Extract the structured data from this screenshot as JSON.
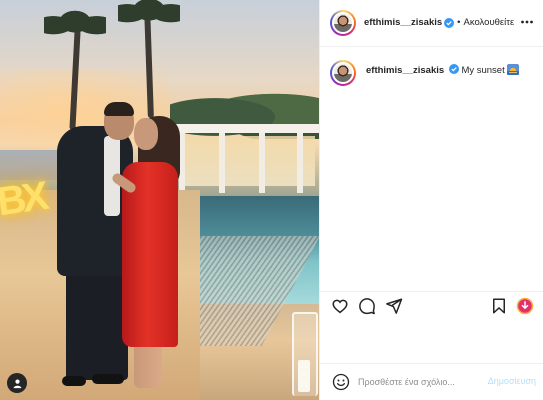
{
  "post": {
    "username": "efthimis__zisakis",
    "verified": true,
    "dot": "•",
    "follow_label": "Ακολουθείτε",
    "caption_text": "My sunset",
    "caption_emoji": "sunset-emoji",
    "comment_placeholder": "Προσθέστε ένα σχόλιο...",
    "post_button_label": "Δημοσίευση",
    "neon_sign_text": "BX"
  },
  "colors": {
    "verified_blue": "#3897f0",
    "post_button_disabled": "#b2dffc",
    "text_primary": "#262626",
    "text_secondary": "#8e8e8e",
    "dress_red": "#e33226"
  },
  "icons": {
    "like": "heart-icon",
    "comment": "comment-bubble-icon",
    "share": "paper-plane-icon",
    "save": "bookmark-icon",
    "more": "more-dots-icon",
    "emoji": "smiley-icon",
    "tagged_user": "user-tag-icon",
    "extension": "download-badge-icon"
  }
}
